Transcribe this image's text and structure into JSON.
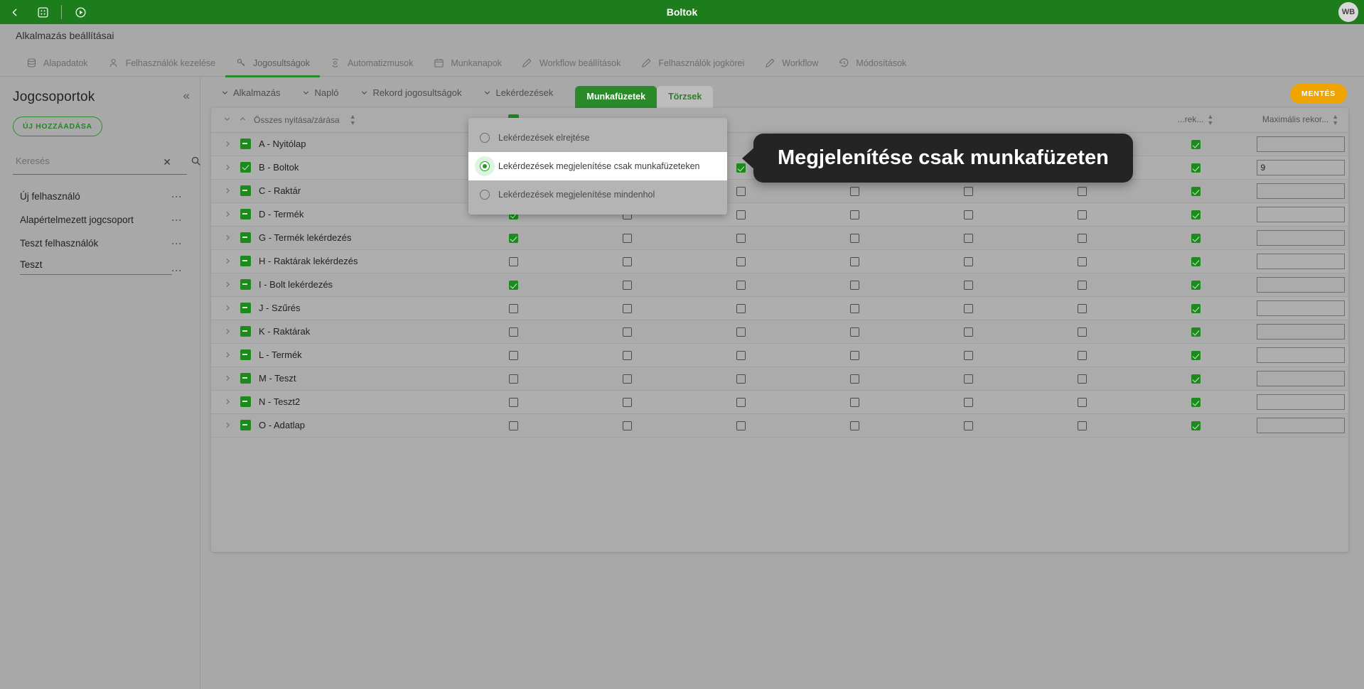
{
  "topbar": {
    "title": "Boltok",
    "back_icon": "chevron-left-icon",
    "apps_icon": "grid-apps-icon",
    "play_icon": "play-circle-icon",
    "avatar_initials": "WB"
  },
  "page": {
    "title": "Alkalmazás beállításai"
  },
  "main_tabs": [
    {
      "label": "Alapadatok",
      "icon": "database-icon",
      "active": false
    },
    {
      "label": "Felhasználók kezelése",
      "icon": "user-icon",
      "active": false
    },
    {
      "label": "Jogosultságok",
      "icon": "key-icon",
      "active": true
    },
    {
      "label": "Automatizmusok",
      "icon": "gear-cycle-icon",
      "active": false
    },
    {
      "label": "Munkanapok",
      "icon": "calendar-icon",
      "active": false
    },
    {
      "label": "Workflow beállítások",
      "icon": "pencil-icon",
      "active": false
    },
    {
      "label": "Felhasználók jogkörei",
      "icon": "pencil-icon",
      "active": false
    },
    {
      "label": "Workflow",
      "icon": "pencil-icon",
      "active": false
    },
    {
      "label": "Módosítások",
      "icon": "history-icon",
      "active": false
    }
  ],
  "sidebar": {
    "title": "Jogcsoportok",
    "collapse_icon": "chevrons-left-icon",
    "add_button": "ÚJ HOZZÁADÁSA",
    "search": {
      "value": "",
      "placeholder": "Keresés",
      "clear_icon": "close-icon",
      "search_icon": "search-icon"
    },
    "items": [
      {
        "label": "Új felhasználó",
        "editing": false
      },
      {
        "label": "Alapértelmezett jogcsoport",
        "editing": false
      },
      {
        "label": "Teszt felhasználók",
        "editing": false
      },
      {
        "label": "Teszt",
        "editing": true
      }
    ],
    "menu_icon": "kebab-menu-icon"
  },
  "subnav": {
    "crumbs": [
      {
        "label": "Alkalmazás",
        "icon": "chevron-down-icon"
      },
      {
        "label": "Napló",
        "icon": "chevron-down-icon"
      },
      {
        "label": "Rekord jogosultságok",
        "icon": "chevron-down-icon"
      },
      {
        "label": "Lekérdezések",
        "icon": "chevron-down-icon"
      }
    ],
    "pills": [
      {
        "label": "Munkafüzetek",
        "selected": true
      },
      {
        "label": "Törzsek",
        "selected": false
      }
    ],
    "save_button": "MENTÉS"
  },
  "dropdown": {
    "options": [
      {
        "label": "Lekérdezések elrejtése",
        "selected": false
      },
      {
        "label": "Lekérdezések megjelenítése csak munkafüzeteken",
        "selected": true
      },
      {
        "label": "Lekérdezések megjelenítése mindenhol",
        "selected": false
      }
    ]
  },
  "tooltip": {
    "text": "Megjelenítése csak munkafüzeten"
  },
  "table": {
    "headers": [
      {
        "label": "Összes nyitása/zárása",
        "sortable": true
      },
      {
        "label": "",
        "sortable": false
      },
      {
        "label": "",
        "sortable": false
      },
      {
        "label": "",
        "sortable": false
      },
      {
        "label": "",
        "sortable": false
      },
      {
        "label": "",
        "sortable": false
      },
      {
        "label": "",
        "sortable": false
      },
      {
        "label": "...rek...",
        "sortable": true
      },
      {
        "label": "Maximális rekor...",
        "sortable": true
      }
    ],
    "header_row_checkbox": "indeterminate",
    "rows": [
      {
        "name": "A - Nyitólap",
        "state": "indeterminate",
        "cells": [
          "on",
          "",
          "",
          "",
          "",
          "",
          "on"
        ],
        "max": ""
      },
      {
        "name": "B - Boltok",
        "state": "on",
        "cells": [
          "on",
          "on",
          "on",
          "on",
          "on",
          "on",
          "on"
        ],
        "max": "9"
      },
      {
        "name": "C - Raktár",
        "state": "indeterminate",
        "cells": [
          "on",
          "on",
          "off",
          "off",
          "off",
          "off",
          "on"
        ],
        "max": ""
      },
      {
        "name": "D - Termék",
        "state": "indeterminate",
        "cells": [
          "on",
          "off",
          "off",
          "off",
          "off",
          "off",
          "on"
        ],
        "max": ""
      },
      {
        "name": "G - Termék lekérdezés",
        "state": "indeterminate",
        "cells": [
          "on",
          "off",
          "off",
          "off",
          "off",
          "off",
          "on"
        ],
        "max": ""
      },
      {
        "name": "H - Raktárak lekérdezés",
        "state": "indeterminate",
        "cells": [
          "off",
          "off",
          "off",
          "off",
          "off",
          "off",
          "on"
        ],
        "max": ""
      },
      {
        "name": "I - Bolt lekérdezés",
        "state": "indeterminate",
        "cells": [
          "on",
          "off",
          "off",
          "off",
          "off",
          "off",
          "on"
        ],
        "max": ""
      },
      {
        "name": "J - Szűrés",
        "state": "indeterminate",
        "cells": [
          "off",
          "off",
          "off",
          "off",
          "off",
          "off",
          "on"
        ],
        "max": ""
      },
      {
        "name": "K - Raktárak",
        "state": "indeterminate",
        "cells": [
          "off",
          "off",
          "off",
          "off",
          "off",
          "off",
          "on"
        ],
        "max": ""
      },
      {
        "name": "L - Termék",
        "state": "indeterminate",
        "cells": [
          "off",
          "off",
          "off",
          "off",
          "off",
          "off",
          "on"
        ],
        "max": ""
      },
      {
        "name": "M - Teszt",
        "state": "indeterminate",
        "cells": [
          "off",
          "off",
          "off",
          "off",
          "off",
          "off",
          "on"
        ],
        "max": ""
      },
      {
        "name": "N - Teszt2",
        "state": "indeterminate",
        "cells": [
          "off",
          "off",
          "off",
          "off",
          "off",
          "off",
          "on"
        ],
        "max": ""
      },
      {
        "name": "O - Adatlap",
        "state": "indeterminate",
        "cells": [
          "off",
          "off",
          "off",
          "off",
          "off",
          "off",
          "on"
        ],
        "max": ""
      }
    ]
  },
  "colors": {
    "brand_green": "#1d7d1d",
    "accent_green": "#2a8a2a",
    "save_orange": "#f0a400",
    "page_bg": "#a8a8a8",
    "tooltip_bg": "#242424"
  }
}
